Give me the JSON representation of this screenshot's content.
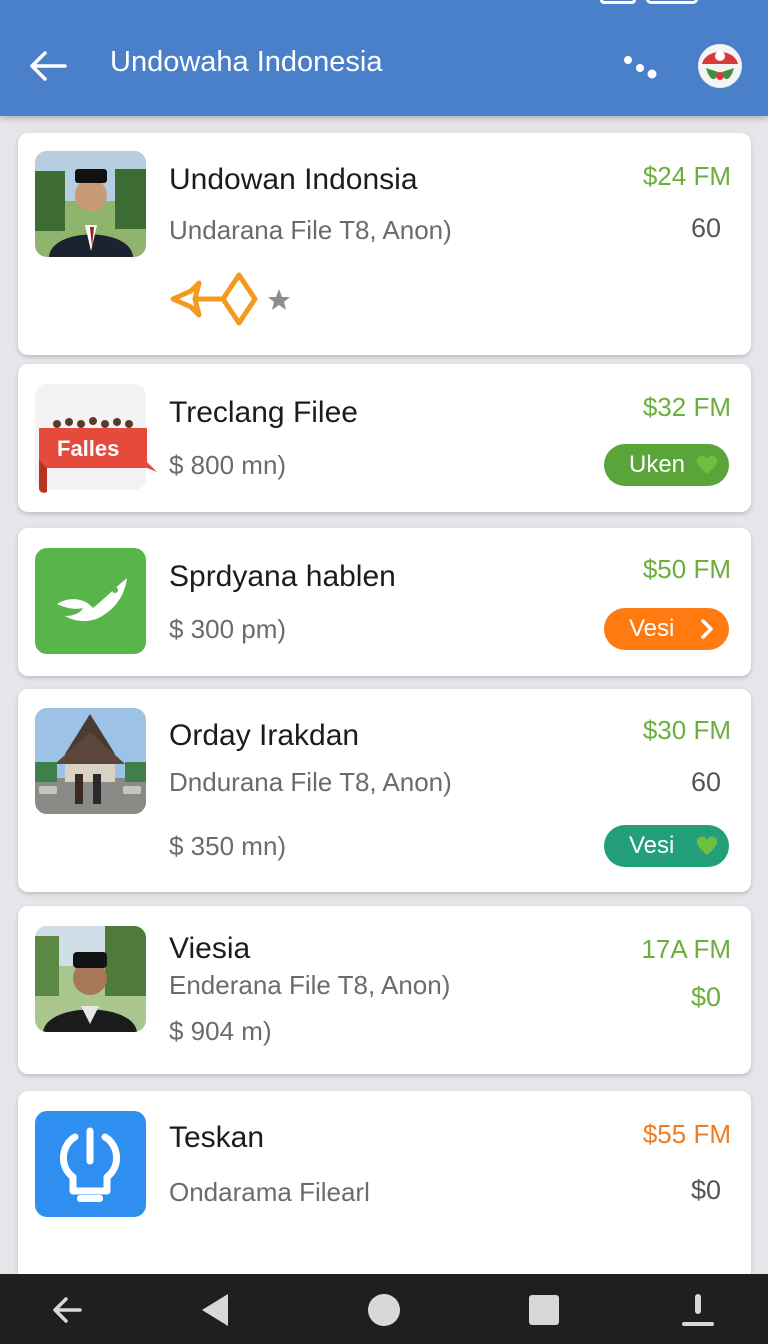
{
  "app": {
    "title": "Undowaha Indonesia"
  },
  "icons": {
    "back": "back-arrow-icon",
    "more": "dots-share-icon",
    "logo": "brand-logo-icon"
  },
  "colors": {
    "appbar": "#4a7fca",
    "price_green": "#6cae3c",
    "price_orange": "#f07c22",
    "pill_green": "#5aa43a",
    "pill_orange": "#ff7b12",
    "pill_teal": "#23a07a"
  },
  "items": [
    {
      "name": "Undowan Indonsia",
      "subtitle": "Undarana File T8, Anon)",
      "price": "$24 FM",
      "value": "60",
      "rating_icon": "arrow-diamond-rating-icon"
    },
    {
      "name": "Treclang Filee",
      "thumb_label": "Falles",
      "subtitle": "$ 800 mn)",
      "price": "$32 FM",
      "button": "Uken"
    },
    {
      "name": "Sprdyana hablen",
      "subtitle": "$ 300 pm)",
      "price": "$50 FM",
      "button": "Vesi"
    },
    {
      "name": "Orday Irakdan",
      "subtitle": "Dndurana File T8, Anon)",
      "subtitle2": "$ 350 mn)",
      "price": "$30 FM",
      "value": "60",
      "button": "Vesi"
    },
    {
      "name": "Viesia",
      "subtitle": "Enderana File T8, Anon)",
      "subtitle2": "$ 904 m)",
      "price": "17A FM",
      "value": "$0"
    },
    {
      "name": "Teskan",
      "subtitle": "Ondarama Filearl",
      "price": "$55 FM",
      "value": "$0"
    }
  ]
}
